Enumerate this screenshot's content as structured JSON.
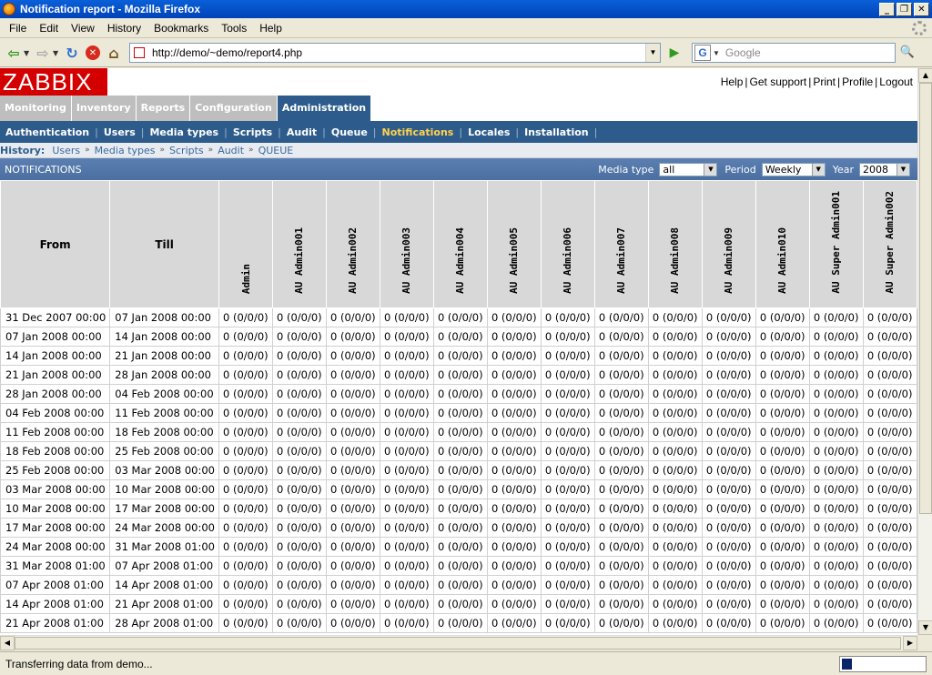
{
  "window": {
    "title": "Notification report - Mozilla Firefox"
  },
  "browser": {
    "menu": [
      "File",
      "Edit",
      "View",
      "History",
      "Bookmarks",
      "Tools",
      "Help"
    ],
    "url": "http://demo/~demo/report4.php",
    "search_placeholder": "Google",
    "status": "Transferring data from demo...",
    "progress": 0.12
  },
  "zabbix": {
    "logo": "ZABBIX",
    "top_links": [
      "Help",
      "Get support",
      "Print",
      "Profile",
      "Logout"
    ],
    "main_menu": [
      {
        "label": "Monitoring",
        "active": false
      },
      {
        "label": "Inventory",
        "active": false
      },
      {
        "label": "Reports",
        "active": false
      },
      {
        "label": "Configuration",
        "active": false
      },
      {
        "label": "Administration",
        "active": true
      }
    ],
    "sub_menu": [
      {
        "label": "Authentication",
        "active": false
      },
      {
        "label": "Users",
        "active": false
      },
      {
        "label": "Media types",
        "active": false
      },
      {
        "label": "Scripts",
        "active": false
      },
      {
        "label": "Audit",
        "active": false
      },
      {
        "label": "Queue",
        "active": false
      },
      {
        "label": "Notifications",
        "active": true
      },
      {
        "label": "Locales",
        "active": false
      },
      {
        "label": "Installation",
        "active": false
      }
    ],
    "history": {
      "label": "History:",
      "items": [
        "Users",
        "Media types",
        "Scripts",
        "Audit",
        "QUEUE"
      ]
    },
    "report": {
      "title": "NOTIFICATIONS",
      "media_type_label": "Media type",
      "media_type_value": "all",
      "period_label": "Period",
      "period_value": "Weekly",
      "year_label": "Year",
      "year_value": "2008"
    },
    "table": {
      "from_header": "From",
      "till_header": "Till",
      "users": [
        "Admin",
        "AU Admin001",
        "AU Admin002",
        "AU Admin003",
        "AU Admin004",
        "AU Admin005",
        "AU Admin006",
        "AU Admin007",
        "AU Admin008",
        "AU Admin009",
        "AU Admin010",
        "AU Super Admin001",
        "AU Super Admin002"
      ],
      "cell_value": "0 (0/0/0)",
      "rows": [
        [
          "31 Dec 2007 00:00",
          "07 Jan 2008 00:00"
        ],
        [
          "07 Jan 2008 00:00",
          "14 Jan 2008 00:00"
        ],
        [
          "14 Jan 2008 00:00",
          "21 Jan 2008 00:00"
        ],
        [
          "21 Jan 2008 00:00",
          "28 Jan 2008 00:00"
        ],
        [
          "28 Jan 2008 00:00",
          "04 Feb 2008 00:00"
        ],
        [
          "04 Feb 2008 00:00",
          "11 Feb 2008 00:00"
        ],
        [
          "11 Feb 2008 00:00",
          "18 Feb 2008 00:00"
        ],
        [
          "18 Feb 2008 00:00",
          "25 Feb 2008 00:00"
        ],
        [
          "25 Feb 2008 00:00",
          "03 Mar 2008 00:00"
        ],
        [
          "03 Mar 2008 00:00",
          "10 Mar 2008 00:00"
        ],
        [
          "10 Mar 2008 00:00",
          "17 Mar 2008 00:00"
        ],
        [
          "17 Mar 2008 00:00",
          "24 Mar 2008 00:00"
        ],
        [
          "24 Mar 2008 00:00",
          "31 Mar 2008 01:00"
        ],
        [
          "31 Mar 2008 01:00",
          "07 Apr 2008 01:00"
        ],
        [
          "07 Apr 2008 01:00",
          "14 Apr 2008 01:00"
        ],
        [
          "14 Apr 2008 01:00",
          "21 Apr 2008 01:00"
        ],
        [
          "21 Apr 2008 01:00",
          "28 Apr 2008 01:00"
        ]
      ]
    }
  }
}
